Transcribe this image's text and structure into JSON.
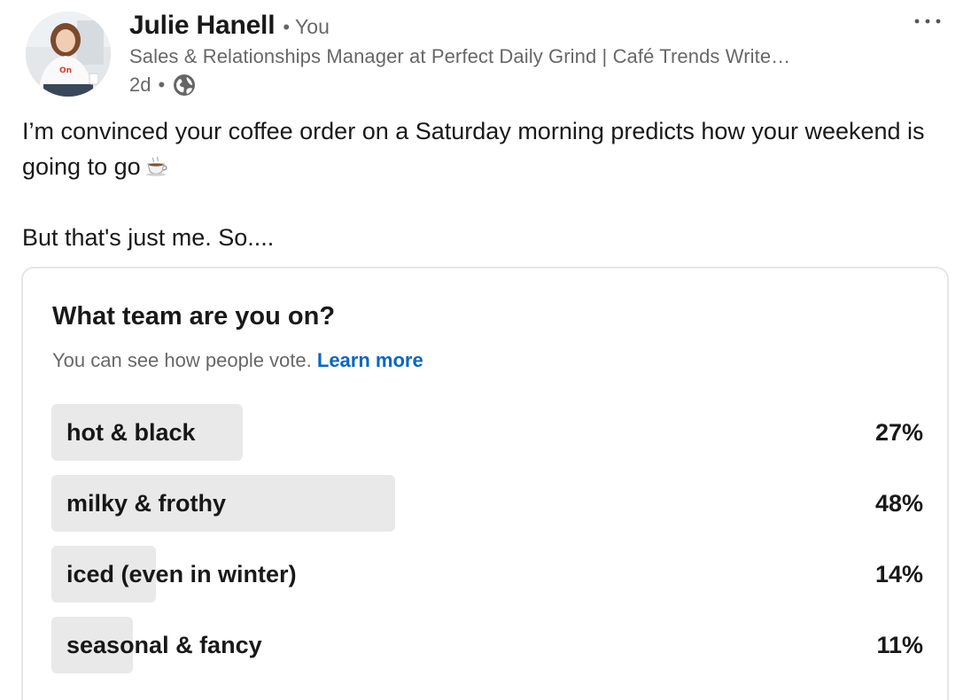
{
  "author": {
    "name": "Julie Hanell",
    "separator": "•",
    "relation": "You",
    "headline": "Sales & Relationships Manager at Perfect Daily Grind | Café Trends Write…",
    "time": "2d",
    "time_separator": "•",
    "visibility_icon": "globe-icon"
  },
  "menu": {
    "icon": "more-horizontal-icon"
  },
  "post": {
    "line1": "I’m convinced your coffee order on a Saturday morning predicts how your weekend is going to go",
    "emoji": "coffee-cup-icon",
    "line2": "But that's just me. So...."
  },
  "poll": {
    "question": "What team are you on?",
    "note": "You can see how people vote.",
    "learn_more": "Learn more",
    "options": [
      {
        "label": "hot & black",
        "percent": "27%",
        "fill": 0.22
      },
      {
        "label": "milky & frothy",
        "percent": "48%",
        "fill": 0.394
      },
      {
        "label": "iced (even in winter)",
        "percent": "14%",
        "fill": 0.12
      },
      {
        "label": "seasonal & fancy",
        "percent": "11%",
        "fill": 0.093
      }
    ]
  },
  "colors": {
    "link": "#0a66c2",
    "bar": "#e9e9e9",
    "border": "#e6e6e6"
  }
}
